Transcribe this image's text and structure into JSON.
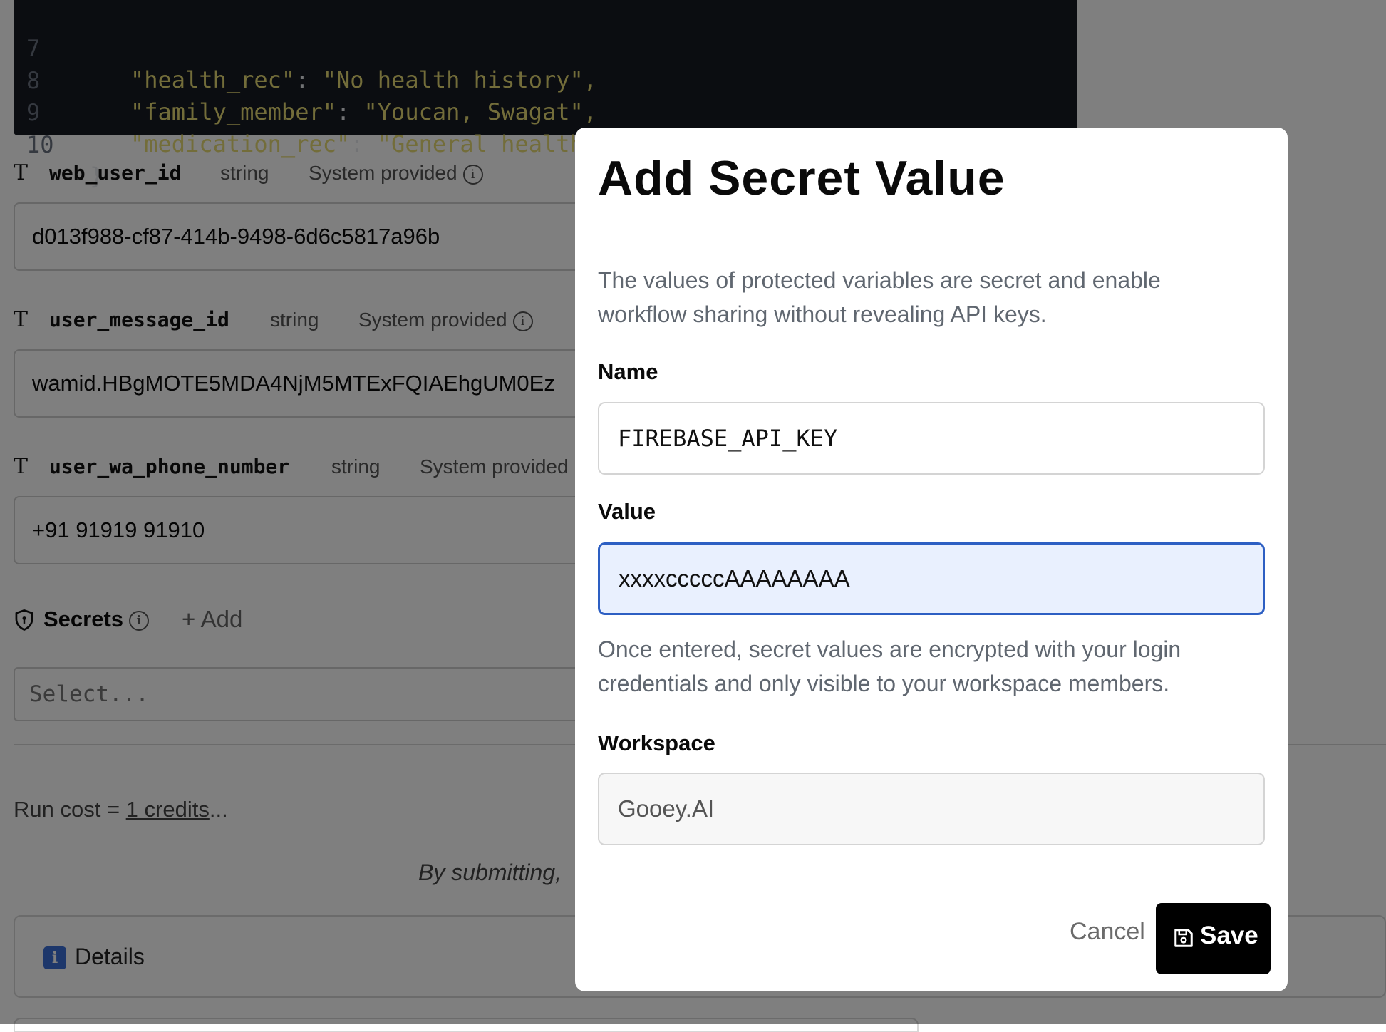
{
  "code_block": {
    "lines": [
      {
        "num": "7",
        "key": "\"health_rec\"",
        "value": "\"No health history\","
      },
      {
        "num": "8",
        "key": "\"family_member\"",
        "value": "\"Youcan, Swagat\","
      },
      {
        "num": "9",
        "key": "\"medication_rec\"",
        "value": "\"General health recommendations provided\""
      },
      {
        "num": "10",
        "key": "}",
        "value": ""
      }
    ]
  },
  "variables": [
    {
      "name": "web_user_id",
      "type": "string",
      "source": "System provided",
      "value": "d013f988-cf87-414b-9498-6d6c5817a96b"
    },
    {
      "name": "user_message_id",
      "type": "string",
      "source": "System provided",
      "value": "wamid.HBgMOTE5MDA4NjM5MTExFQIAEhgUM0Ez"
    },
    {
      "name": "user_wa_phone_number",
      "type": "string",
      "source": "System provided",
      "value": "+91 91919 91910"
    }
  ],
  "secrets": {
    "label": "Secrets",
    "add_label": "+ Add",
    "select_placeholder": "Select..."
  },
  "run_cost": {
    "prefix": "Run cost = ",
    "link": "1 credits",
    "suffix": "..."
  },
  "submitting_text": "By submitting,",
  "details_label": "Details",
  "modal": {
    "title": "Add Secret Value",
    "description": "The values of protected variables are secret and enable workflow sharing without revealing API keys.",
    "name_label": "Name",
    "name_value": "FIREBASE_API_KEY",
    "value_label": "Value",
    "value_value": "xxxxcccccAAAAAAAA",
    "note": "Once entered, secret values are encrypted with your login credentials and only visible to your workspace members.",
    "workspace_label": "Workspace",
    "workspace_value": "Gooey.AI",
    "cancel_label": "Cancel",
    "save_label": "Save"
  },
  "colors": {
    "code_bg": "#161a22",
    "code_string": "#e6db74",
    "focus_border": "#2d5fc3",
    "focus_bg": "#e9f0fe",
    "save_bg": "#000000"
  }
}
